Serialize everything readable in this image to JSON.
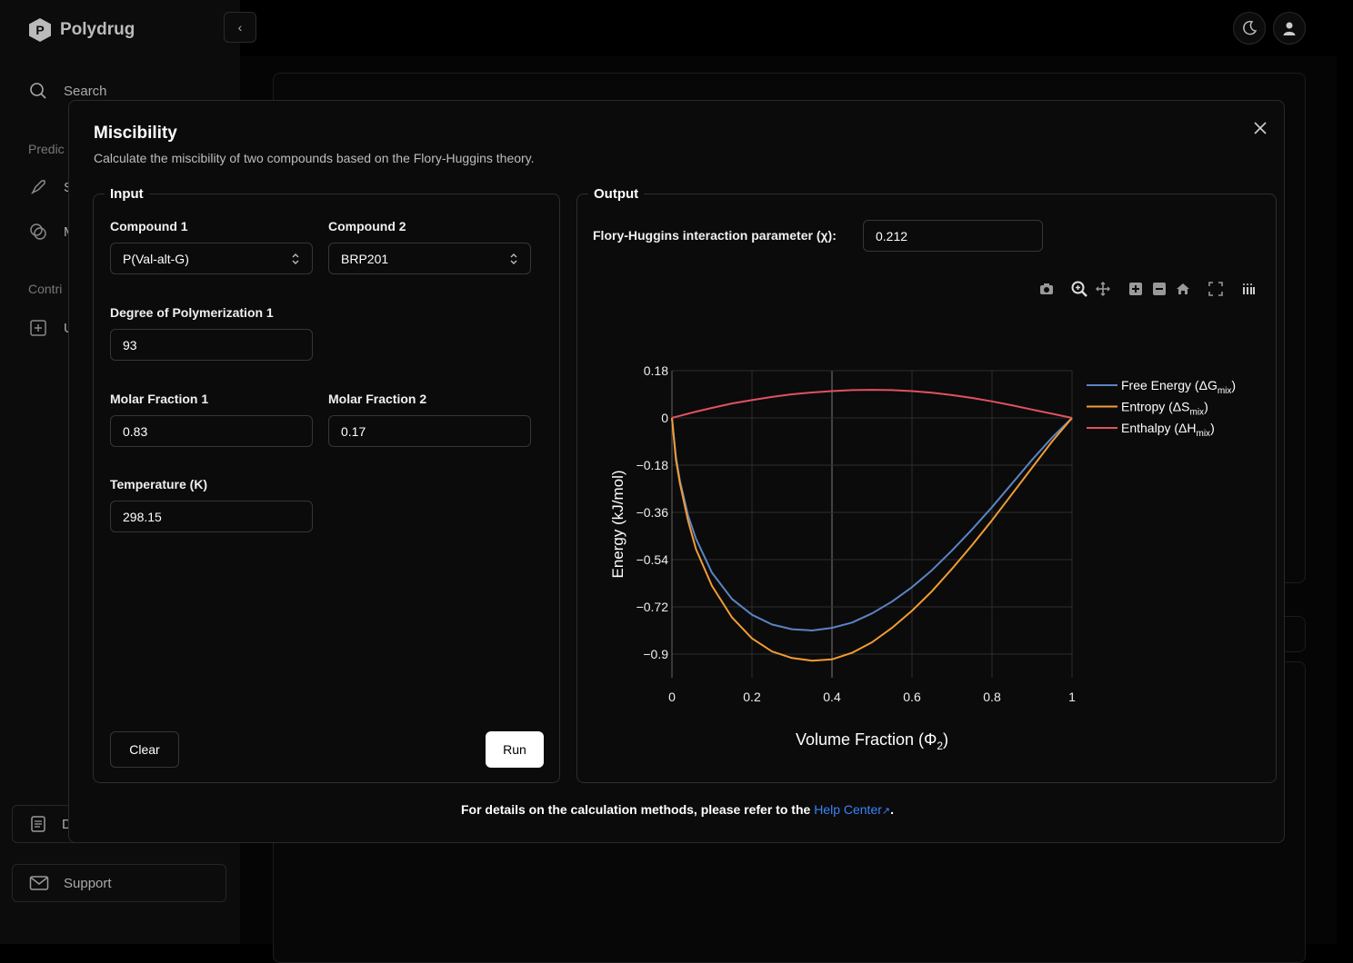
{
  "app": {
    "name": "Polydrug",
    "logo_letter": "P"
  },
  "sidebar": {
    "search_label": "Search",
    "section_predict": "Predic",
    "section_contribute": "Contri",
    "item_s": "S",
    "item_m": "M",
    "item_u": "U",
    "item_docs": "D",
    "support_label": "Support"
  },
  "modal": {
    "title": "Miscibility",
    "subtitle": "Calculate the miscibility of two compounds based on the Flory-Huggins theory.",
    "input_legend": "Input",
    "output_legend": "Output",
    "compound1_label": "Compound 1",
    "compound1_value": "P(Val-alt-G)",
    "compound2_label": "Compound 2",
    "compound2_value": "BRP201",
    "dp1_label": "Degree of Polymerization 1",
    "dp1_value": "93",
    "molar1_label": "Molar Fraction 1",
    "molar1_value": "0.83",
    "molar2_label": "Molar Fraction 2",
    "molar2_value": "0.17",
    "temp_label": "Temperature (K)",
    "temp_value": "298.15",
    "clear_label": "Clear",
    "run_label": "Run",
    "chi_label": "Flory-Huggins interaction parameter (χ):",
    "chi_value": "0.212",
    "footer_text": "For details on the calculation methods, please refer to the",
    "footer_link": "Help Center",
    "footer_end": "."
  },
  "colors": {
    "free_energy": "#5b84c4",
    "entropy": "#f39c34",
    "enthalpy": "#e05260",
    "link": "#3b82f6"
  },
  "chart_data": {
    "type": "line",
    "xlabel": "Volume Fraction (Φ2)",
    "ylabel": "Energy (kJ/mol)",
    "xlim": [
      0,
      1
    ],
    "ylim": [
      -0.99,
      0.18
    ],
    "xticks": [
      "0",
      "0.2",
      "0.4",
      "0.6",
      "0.8",
      "1"
    ],
    "yticks": [
      "0.18",
      "0",
      "−0.18",
      "−0.36",
      "−0.54",
      "−0.72",
      "−0.9"
    ],
    "x": [
      0,
      0.01,
      0.02,
      0.04,
      0.06,
      0.1,
      0.15,
      0.2,
      0.25,
      0.3,
      0.35,
      0.4,
      0.45,
      0.5,
      0.55,
      0.6,
      0.65,
      0.7,
      0.75,
      0.8,
      0.85,
      0.9,
      0.95,
      1.0
    ],
    "series": [
      {
        "name": "Free Energy",
        "sub": "mix",
        "symbol": "ΔG",
        "values": [
          0,
          -0.15,
          -0.24,
          -0.37,
          -0.46,
          -0.59,
          -0.69,
          -0.75,
          -0.787,
          -0.805,
          -0.81,
          -0.8,
          -0.78,
          -0.745,
          -0.7,
          -0.645,
          -0.58,
          -0.505,
          -0.425,
          -0.34,
          -0.25,
          -0.16,
          -0.075,
          0
        ]
      },
      {
        "name": "Entropy",
        "sub": "mix",
        "symbol": "ΔS",
        "values": [
          0,
          -0.16,
          -0.25,
          -0.39,
          -0.5,
          -0.64,
          -0.76,
          -0.84,
          -0.89,
          -0.915,
          -0.925,
          -0.92,
          -0.895,
          -0.855,
          -0.8,
          -0.735,
          -0.66,
          -0.575,
          -0.485,
          -0.39,
          -0.29,
          -0.19,
          -0.09,
          0
        ]
      },
      {
        "name": "Enthalpy",
        "sub": "mix",
        "symbol": "ΔH",
        "values": [
          0,
          0.004,
          0.008,
          0.016,
          0.024,
          0.038,
          0.055,
          0.068,
          0.08,
          0.09,
          0.097,
          0.102,
          0.106,
          0.107,
          0.106,
          0.102,
          0.096,
          0.087,
          0.076,
          0.063,
          0.048,
          0.032,
          0.016,
          0
        ]
      }
    ]
  }
}
